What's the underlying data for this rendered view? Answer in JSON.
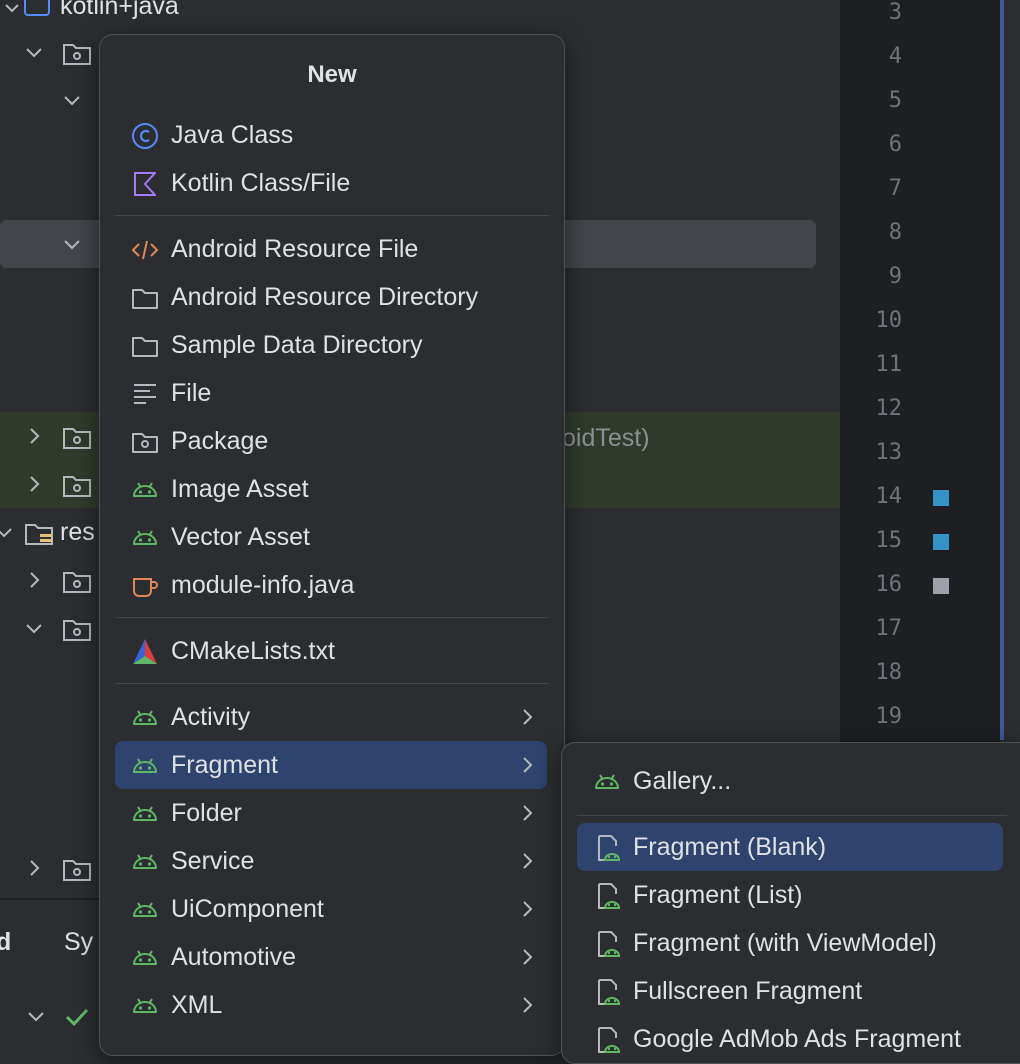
{
  "tree": {
    "root_label": "kotlin+java",
    "android_test_suffix": "oidTest)",
    "res_label": "res",
    "bottom_tab_1": "d",
    "bottom_tab_2": "Sy"
  },
  "gutter": {
    "line_numbers": [
      "3",
      "4",
      "5",
      "6",
      "7",
      "8",
      "9",
      "10",
      "11",
      "12",
      "13",
      "14",
      "15",
      "16",
      "17",
      "18",
      "19"
    ],
    "markers": [
      {
        "line": "14",
        "color": "#3592c4"
      },
      {
        "line": "15",
        "color": "#3592c4"
      },
      {
        "line": "16",
        "color": "#9da0a8"
      }
    ]
  },
  "menu_new": {
    "title": "New",
    "items": [
      {
        "label": "Java Class",
        "icon": "java-class-icon"
      },
      {
        "label": "Kotlin Class/File",
        "icon": "kotlin-icon"
      },
      {
        "label": "Android Resource File",
        "icon": "xml-code-icon"
      },
      {
        "label": "Android Resource Directory",
        "icon": "folder-icon"
      },
      {
        "label": "Sample Data Directory",
        "icon": "folder-icon"
      },
      {
        "label": "File",
        "icon": "text-file-icon"
      },
      {
        "label": "Package",
        "icon": "package-icon"
      },
      {
        "label": "Image Asset",
        "icon": "android-icon"
      },
      {
        "label": "Vector Asset",
        "icon": "android-icon"
      },
      {
        "label": "module-info.java",
        "icon": "java-cup-icon"
      },
      {
        "label": "CMakeLists.txt",
        "icon": "cmake-icon"
      },
      {
        "label": "Activity",
        "icon": "android-icon",
        "submenu": true
      },
      {
        "label": "Fragment",
        "icon": "android-icon",
        "submenu": true,
        "active": true
      },
      {
        "label": "Folder",
        "icon": "android-icon",
        "submenu": true
      },
      {
        "label": "Service",
        "icon": "android-icon",
        "submenu": true
      },
      {
        "label": "UiComponent",
        "icon": "android-icon",
        "submenu": true
      },
      {
        "label": "Automotive",
        "icon": "android-icon",
        "submenu": true
      },
      {
        "label": "XML",
        "icon": "android-icon",
        "submenu": true
      }
    ]
  },
  "menu_fragment": {
    "items": [
      {
        "label": "Gallery...",
        "icon": "android-icon"
      },
      {
        "label": "Fragment (Blank)",
        "icon": "fragment-template-icon",
        "active": true
      },
      {
        "label": "Fragment (List)",
        "icon": "fragment-template-icon"
      },
      {
        "label": "Fragment (with ViewModel)",
        "icon": "fragment-template-icon"
      },
      {
        "label": "Fullscreen Fragment",
        "icon": "fragment-template-icon"
      },
      {
        "label": "Google AdMob Ads Fragment",
        "icon": "fragment-template-icon"
      }
    ]
  },
  "colors": {
    "accent_selection": "#2e436e",
    "android_green": "#5fb865",
    "java_blue": "#548af7",
    "kotlin_purple": "#a57cf5",
    "xml_orange": "#e08855"
  }
}
